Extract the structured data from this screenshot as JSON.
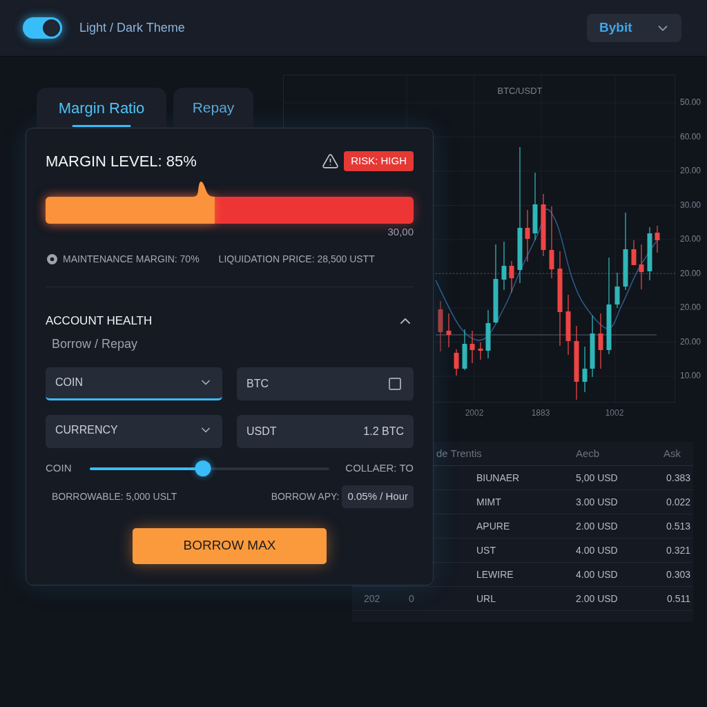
{
  "top_bar": {
    "theme_toggle": {
      "label": "Light / Dark Theme",
      "on": true
    },
    "exchange_select": {
      "value": "Bybit"
    }
  },
  "tabs": [
    {
      "label": "Margin Ratio",
      "selected": true
    },
    {
      "label": "Repay",
      "selected": false
    }
  ],
  "margin_level": {
    "title": "MARGIN LEVEL: 85%",
    "risk_badge": "RISK: HIGH",
    "bar": {
      "level": 0.46,
      "end_label": "30,00"
    },
    "stats": [
      "MAINTENANCE MARGIN: 70%",
      "LIQUIDATION PRICE: 28,500 USTT"
    ]
  },
  "account_health": {
    "title": "ACCOUNT HEALTH",
    "expanded": true,
    "subtitle": "Borrow / Repay",
    "fields": [
      {
        "kind": "select",
        "value": "COIN",
        "focused": true
      },
      {
        "kind": "checkbox_field",
        "value": "BTC",
        "checked": false
      },
      {
        "kind": "select",
        "value": "CURRENCY",
        "focused": false
      },
      {
        "kind": "amount_field",
        "value": "USDT",
        "amount": "1.2 BTC"
      }
    ],
    "slider": {
      "left_label": "COIN",
      "right_label": "COLLAER: TO",
      "level": 0.475
    },
    "borrowable": "BORROWABLE: 5,000 USLT",
    "apy_label": "BORROW APY:",
    "apy_value": "0.05% / Hour",
    "button": "BORROW MAX"
  },
  "chart": {
    "title": "BTC/USDT",
    "y_labels": [
      "50.00",
      "60.00",
      "20.00",
      "30.00",
      "20.00",
      "20.00",
      "20.00",
      "20.00",
      "10.00"
    ],
    "x_labels": [
      "2002",
      "1883",
      "1002"
    ]
  },
  "table": {
    "header": {
      "column_3": "de Trentis",
      "column_4": "Aecb",
      "column_5": "Ask"
    },
    "rows": [
      {
        "column_3": "BIUNAER",
        "column_4": "5,00 USD",
        "column_5": "0.383"
      },
      {
        "column_3": "MIMT",
        "column_4": "3.00 USD",
        "column_5": "0.022"
      },
      {
        "column_3": "APURE",
        "column_4": "2.00 USD",
        "column_5": "0.513"
      },
      {
        "column_3": "UST",
        "column_4": "4.00 USD",
        "column_5": "0.321"
      },
      {
        "column_3": "LEWIRE",
        "column_4": "4.00 USD",
        "column_5": "0.303"
      },
      {
        "column_1": "202",
        "column_2": "0",
        "column_3": "URL",
        "column_4": "2.00 USD",
        "column_5": "0.511"
      }
    ]
  }
}
